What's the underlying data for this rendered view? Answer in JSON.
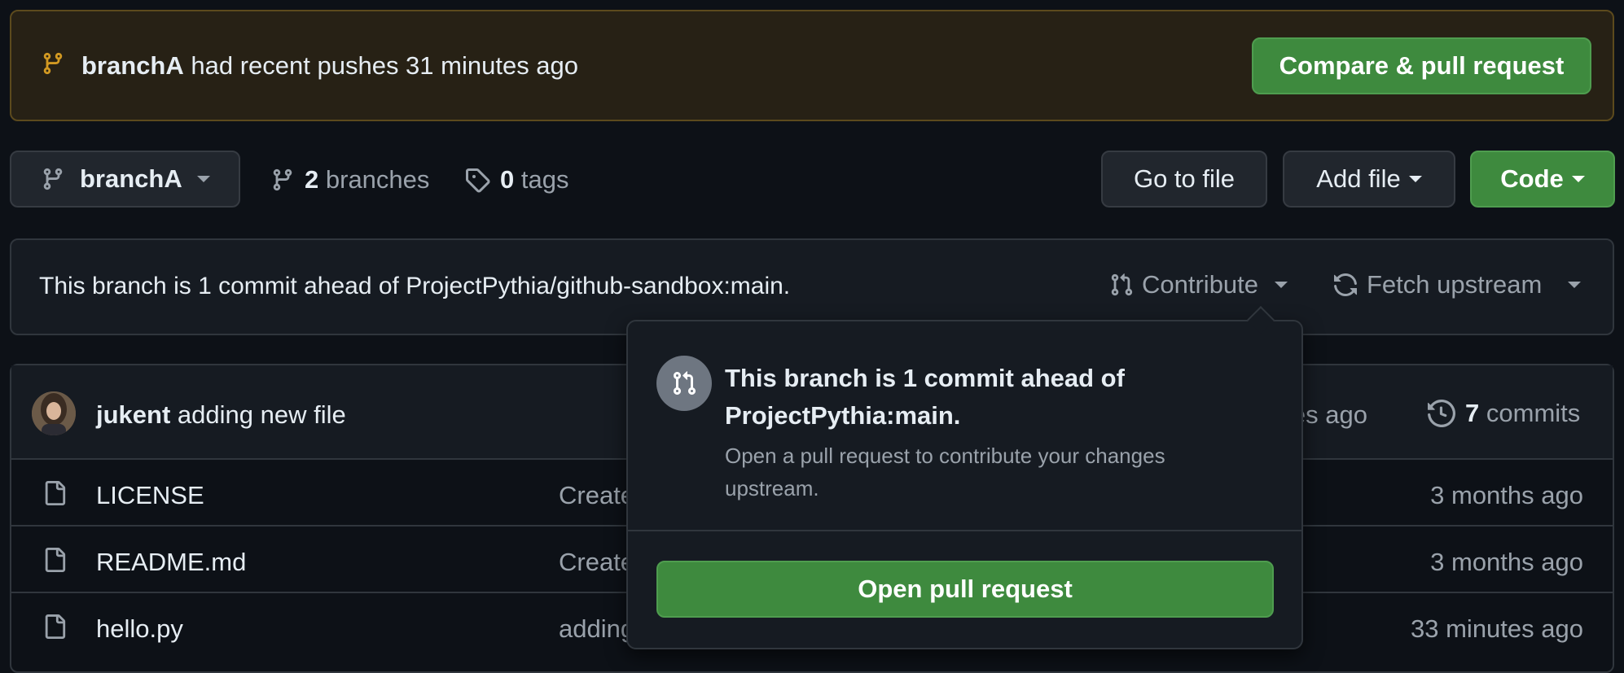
{
  "banner": {
    "branch": "branchA",
    "message": "had recent pushes 31 minutes ago",
    "compare_button": "Compare & pull request"
  },
  "toolbar": {
    "branch_select": "branchA",
    "branches_count": "2",
    "branches_label": "branches",
    "tags_count": "0",
    "tags_label": "tags",
    "go_to_file": "Go to file",
    "add_file": "Add file",
    "code": "Code"
  },
  "ahead_bar": {
    "message": "This branch is 1 commit ahead of ProjectPythia/github-sandbox:main.",
    "contribute": "Contribute",
    "fetch_upstream": "Fetch upstream"
  },
  "popover": {
    "title": "This branch is 1 commit ahead of ProjectPythia:main.",
    "description": "Open a pull request to contribute your changes upstream.",
    "open_pr_button": "Open pull request"
  },
  "latest_commit": {
    "author": "jukent",
    "message": "adding new file",
    "time_fragment": "utes ago",
    "commits_count": "7",
    "commits_label": "commits"
  },
  "files": [
    {
      "name": "LICENSE",
      "message": "Create",
      "time": "3 months ago"
    },
    {
      "name": "README.md",
      "message": "Create",
      "time": "3 months ago"
    },
    {
      "name": "hello.py",
      "message": "adding",
      "time": "33 minutes ago"
    }
  ],
  "colors": {
    "background": "#0d1117",
    "banner_bg": "#272115",
    "accent_green": "#3e8a3e",
    "branch_icon_yellow": "#d29922"
  }
}
